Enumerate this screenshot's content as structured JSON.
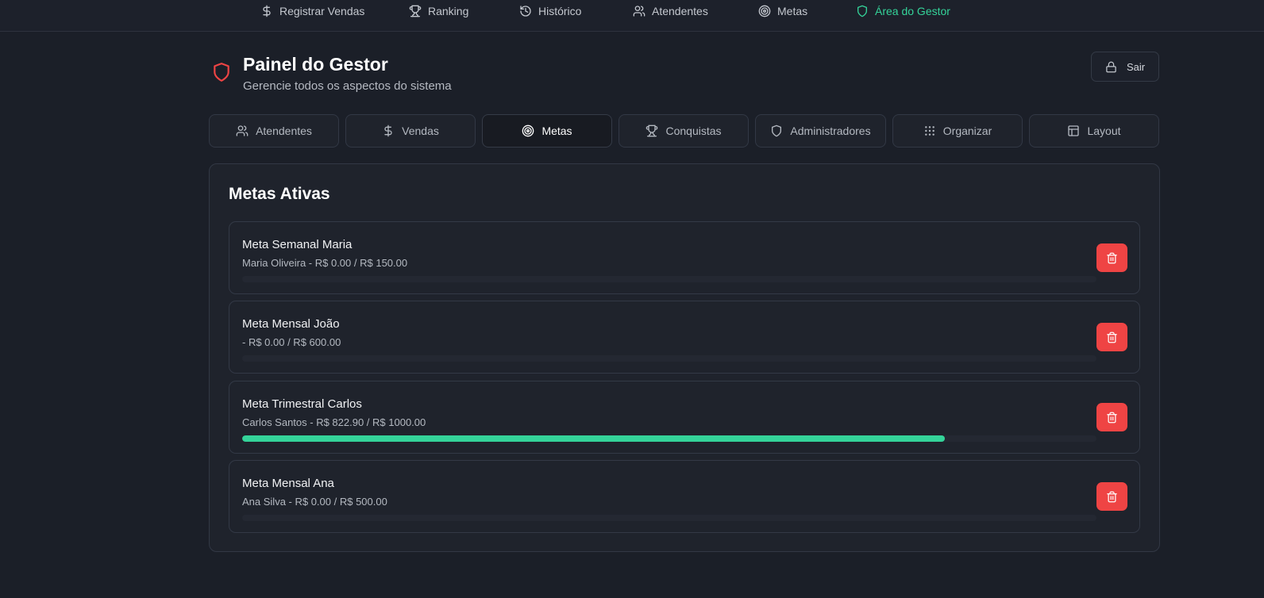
{
  "topnav": {
    "items": [
      {
        "label": "Registrar Vendas",
        "icon": "dollar-icon"
      },
      {
        "label": "Ranking",
        "icon": "trophy-icon"
      },
      {
        "label": "Histórico",
        "icon": "history-icon"
      },
      {
        "label": "Atendentes",
        "icon": "users-icon"
      },
      {
        "label": "Metas",
        "icon": "target-icon"
      },
      {
        "label": "Área do Gestor",
        "icon": "shield-icon",
        "active": true
      }
    ]
  },
  "header": {
    "title": "Painel do Gestor",
    "subtitle": "Gerencie todos os aspectos do sistema",
    "logout_label": "Sair"
  },
  "tabs": [
    {
      "label": "Atendentes",
      "icon": "users-icon"
    },
    {
      "label": "Vendas",
      "icon": "dollar-icon"
    },
    {
      "label": "Metas",
      "icon": "target-icon",
      "active": true
    },
    {
      "label": "Conquistas",
      "icon": "trophy-icon"
    },
    {
      "label": "Administradores",
      "icon": "shield-icon"
    },
    {
      "label": "Organizar",
      "icon": "grid-dots-icon"
    },
    {
      "label": "Layout",
      "icon": "layout-icon"
    }
  ],
  "goals_section": {
    "title": "Metas Ativas",
    "goals": [
      {
        "name": "Meta Semanal Maria",
        "detail": "Maria Oliveira - R$ 0.00 / R$ 150.00",
        "progress": 0.0
      },
      {
        "name": "Meta Mensal João",
        "detail": "- R$ 0.00 / R$ 600.00",
        "progress": 0.0
      },
      {
        "name": "Meta Trimestral Carlos",
        "detail": "Carlos Santos - R$ 822.90 / R$ 1000.00",
        "progress": 0.8229
      },
      {
        "name": "Meta Mensal Ana",
        "detail": "Ana Silva - R$ 0.00 / R$ 500.00",
        "progress": 0.0
      }
    ]
  },
  "colors": {
    "accent_green": "#34d399",
    "danger_red": "#ef4444",
    "background": "#1b1f28"
  }
}
